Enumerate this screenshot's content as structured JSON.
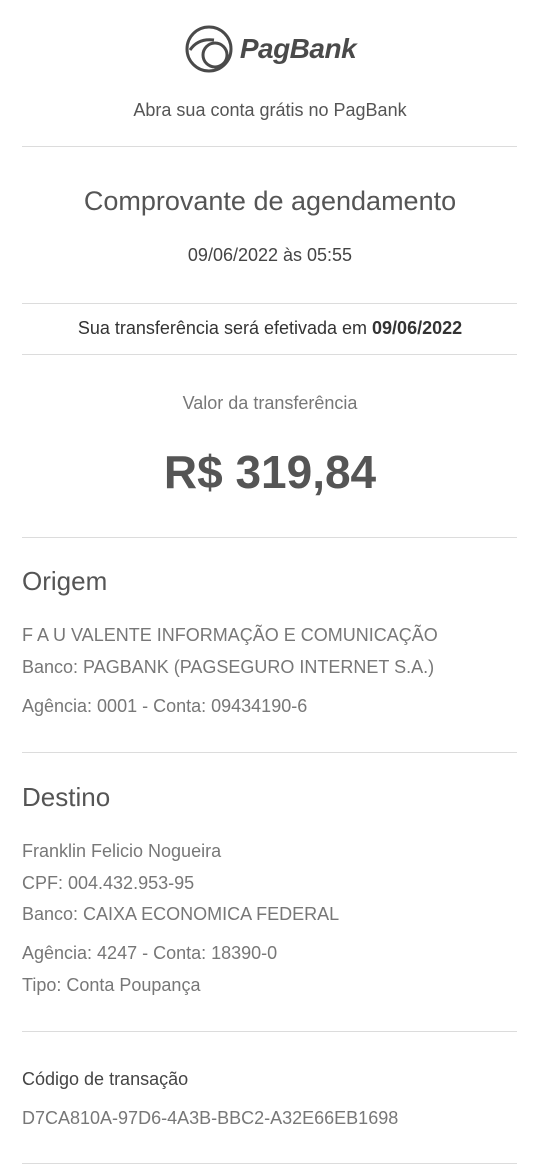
{
  "brand": {
    "name": "PagBank",
    "tagline": "Abra sua conta grátis no PagBank"
  },
  "receipt": {
    "title": "Comprovante de agendamento",
    "datetime": "09/06/2022 às 05:55",
    "scheduled_prefix": "Sua transferência será efetivada em ",
    "scheduled_date": "09/06/2022",
    "amount_label": "Valor da transferência",
    "amount": "R$ 319,84"
  },
  "origin": {
    "heading": "Origem",
    "name": "F A U VALENTE INFORMAÇÃO E COMUNICAÇÃO",
    "bank": "Banco: PAGBANK (PAGSEGURO INTERNET S.A.)",
    "account": "Agência: 0001 - Conta: 09434190-6"
  },
  "destination": {
    "heading": "Destino",
    "name": "Franklin Felicio Nogueira",
    "cpf": "CPF: 004.432.953-95",
    "bank": "Banco: CAIXA ECONOMICA FEDERAL",
    "account": "Agência: 4247 - Conta: 18390-0",
    "type": "Tipo: Conta Poupança"
  },
  "transaction": {
    "label": "Código de transação",
    "code": "D7CA810A-97D6-4A3B-BBC2-A32E66EB1698"
  }
}
